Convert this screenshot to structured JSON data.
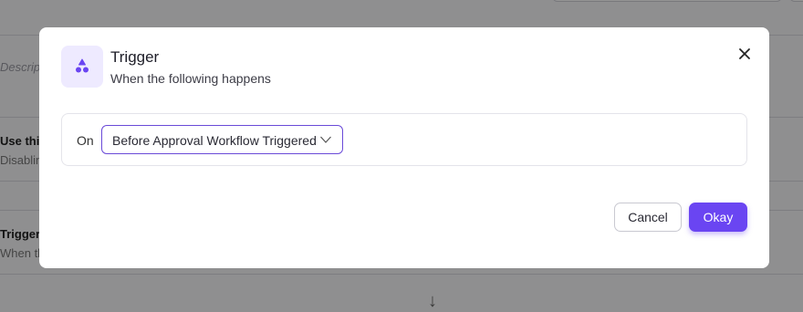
{
  "background": {
    "description_placeholder": "Descript",
    "use_this_label": "Use this",
    "disabling_text": "Disablin",
    "trigger_label": "Trigger",
    "when_text": "When th"
  },
  "modal": {
    "title": "Trigger",
    "subtitle": "When the following happens",
    "on_label": "On",
    "selected_trigger": "Before Approval Workflow Triggered",
    "cancel_label": "Cancel",
    "okay_label": "Okay"
  },
  "colors": {
    "accent": "#6a45f2",
    "icon_bg": "#eeeaff"
  }
}
